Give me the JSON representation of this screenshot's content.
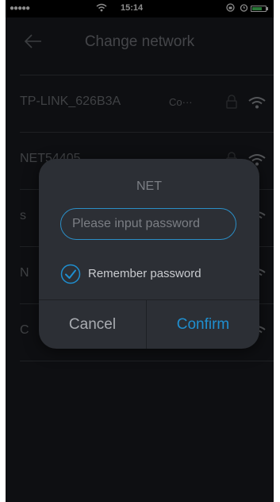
{
  "status": {
    "signal": "●●●●●",
    "time": "15:14"
  },
  "header": {
    "title": "Change network"
  },
  "networks": [
    {
      "name": "TP-LINK_626B3A",
      "state": "Co···"
    },
    {
      "name": "NET54405",
      "state": ""
    },
    {
      "name": "s",
      "state": ""
    },
    {
      "name": "N",
      "state": ""
    },
    {
      "name": "C",
      "state": ""
    }
  ],
  "dialog": {
    "title": "NET",
    "password_placeholder": "Please input password",
    "password_value": "",
    "remember_label": "Remember password",
    "remember_checked": true,
    "cancel_label": "Cancel",
    "confirm_label": "Confirm"
  },
  "colors": {
    "accent": "#1f8fd0",
    "background": "#1a1c21",
    "dialog": "#2c2f35"
  }
}
